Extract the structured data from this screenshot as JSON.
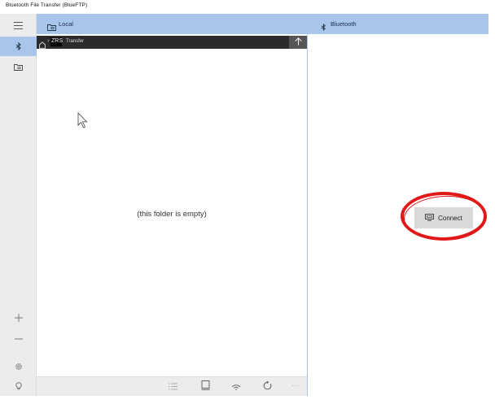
{
  "window": {
    "title": "Bluetooth File Transfer (BlueFTP)"
  },
  "panes": {
    "local": {
      "title": "Local"
    },
    "bluetooth": {
      "title": "Bluetooth"
    }
  },
  "path": {
    "segment": "ZRS",
    "folder": "Transfer",
    "separator": "›"
  },
  "local_content": {
    "empty_message": "(this folder is empty)"
  },
  "bluetooth_panel": {
    "connect_label": "Connect"
  },
  "bottombar": {
    "more": "···"
  },
  "colors": {
    "accent": "#a8c6ec",
    "pathbar": "#2b2b2b",
    "highlight": "#e01818"
  },
  "icons": [
    "hamburger-icon",
    "bluetooth-icon",
    "folder-icon",
    "plus-icon",
    "minus-icon",
    "gear-icon",
    "lightbulb-icon",
    "home-icon",
    "up-arrow-icon",
    "list-icon",
    "device-icon",
    "signal-icon",
    "refresh-icon",
    "computer-icon"
  ]
}
